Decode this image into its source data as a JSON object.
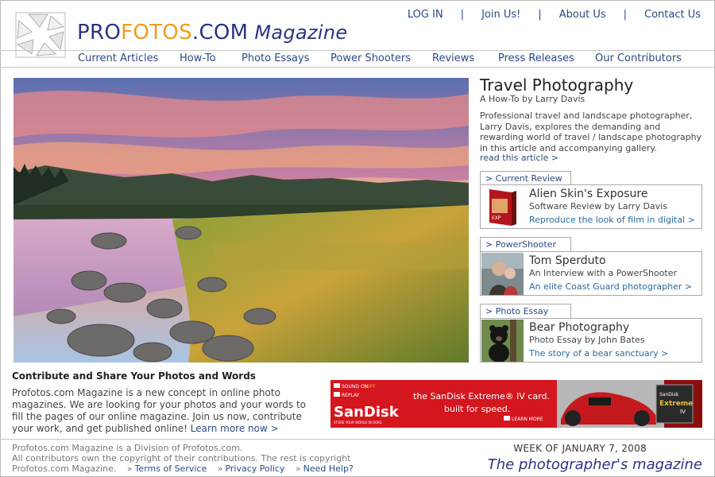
{
  "brand": {
    "pro": "PRO",
    "fotos": "FOTOS",
    "com": ".COM",
    "magazine": "Magazine"
  },
  "toplinks": {
    "login": "LOG IN",
    "join": "Join Us!",
    "about": "About Us",
    "contact": "Contact Us",
    "separator": "|"
  },
  "nav": [
    "Current Articles",
    "How-To",
    "Photo Essays",
    "Power Shooters",
    "Reviews",
    "Press Releases",
    "Our Contributors"
  ],
  "feature": {
    "title": "Travel Photography",
    "byline": "A How-To by Larry Davis",
    "body": "Professional travel and landscape photographer, Larry Davis, explores the demanding and rewarding world of travel / landscape photography in this article and accompanying gallery.",
    "more": "read this article >"
  },
  "cards": [
    {
      "tab": "> Current Review",
      "title": "Alien Skin's Exposure",
      "sub": "Software Review by Larry Davis",
      "link": "Reproduce the look of film in digital >",
      "thumb_icon": "software-box-icon"
    },
    {
      "tab": "> PowerShooter",
      "title": "Tom Sperduto",
      "sub": "An Interview with a PowerShooter",
      "link": "An elite Coast Guard photographer >",
      "thumb_icon": "portrait-icon"
    },
    {
      "tab": "> Photo Essay",
      "title": "Bear Photography",
      "sub": "Photo Essay by John Bates",
      "link": "The story of a bear sanctuary >",
      "thumb_icon": "bear-icon"
    }
  ],
  "contribute": {
    "heading": "Contribute and Share Your Photos and Words",
    "body": "Profotos.com Magazine is a new concept in online photo magazines. We are looking for your photos and your words to fill the pages of our online magazine. Join us now, contribute your work, and get published online!",
    "link": "Learn more now >"
  },
  "ad": {
    "sound_on": "SOUND ON",
    "sound_off": "/OFF",
    "replay": "REPLAY",
    "brand": "SanDisk",
    "brand_tag": "STORE YOUR WORLD IN OURS",
    "headline1": "the SanDisk Extreme® IV card.",
    "headline2": "built for speed.",
    "learn": "LEARN MORE",
    "card_label": "Extreme",
    "card_brand": "SanDisk",
    "card_size": "IV"
  },
  "footer": {
    "line1": "Profotos.com Magazine is a Division of Profotos.com.",
    "line2": "All contributors own the copyright of their contributions. The rest is copyright Profotos.com Magazine.",
    "terms": "Terms of Service",
    "privacy": "Privacy Policy",
    "help": "Need Help?",
    "raquo": "»",
    "week": "WEEK OF JANUARY 7, 2008",
    "tagline": "The photographer's magazine"
  },
  "colors": {
    "brand_blue": "#2a3480",
    "brand_orange": "#f29b1f",
    "link_blue": "#2a4a86",
    "ad_red": "#d4161f"
  }
}
